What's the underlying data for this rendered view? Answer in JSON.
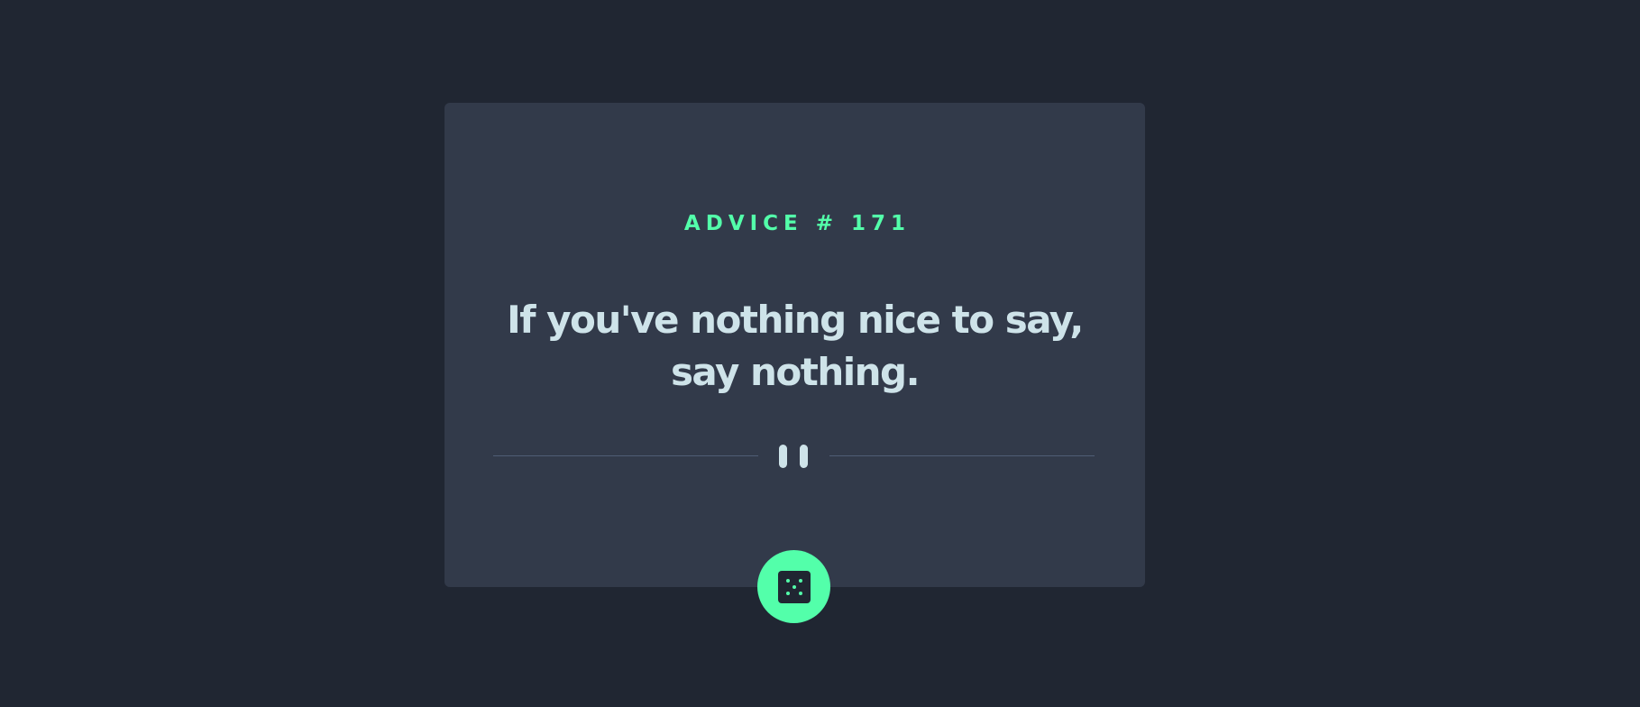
{
  "advice": {
    "label": "ADVICE # 171",
    "text": "If you've nothing nice to say, say nothing."
  },
  "icons": {
    "divider": "pause-icon",
    "button": "dice-icon"
  },
  "colors": {
    "background": "#202632",
    "card": "#323a4a",
    "accent": "#53ffaa",
    "text": "#cee3e9",
    "divider": "#4f5d74"
  }
}
